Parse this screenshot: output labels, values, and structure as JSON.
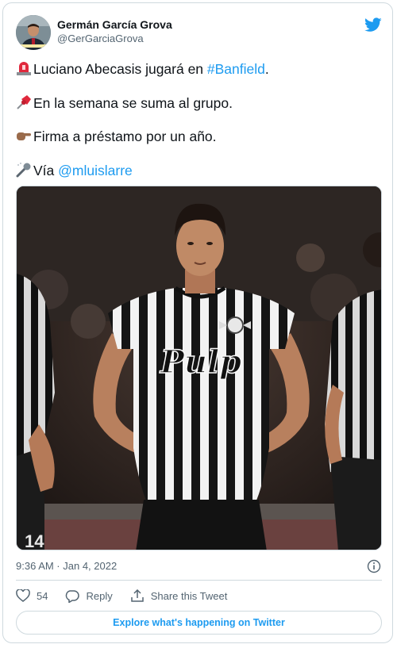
{
  "tweet": {
    "author_name": "Germán García Grova",
    "author_handle": "@GerGarciaGrova",
    "lines": [
      {
        "icon": "rotating-light-icon",
        "text": "Luciano Abecasis jugará en ",
        "link": "#Banfield",
        "after": "."
      },
      {
        "icon": "pushpin-icon",
        "text": "En la semana se suma al grupo."
      },
      {
        "icon": "pointing-hand-icon",
        "text": "Firma a préstamo por un año."
      },
      {
        "icon": "microphone-icon",
        "text": "Vía ",
        "link": "@mluislarre"
      }
    ],
    "image_text": "Pulp",
    "jersey_number": "14",
    "timestamp": "9:36 AM · Jan 4, 2022",
    "likes_count": "54",
    "reply_label": "Reply",
    "share_label": "Share this Tweet",
    "explore_label": "Explore what's happening on Twitter"
  },
  "colors": {
    "accent": "#1d9bf0",
    "secondary_text": "#536471",
    "border": "#cfd9de"
  }
}
